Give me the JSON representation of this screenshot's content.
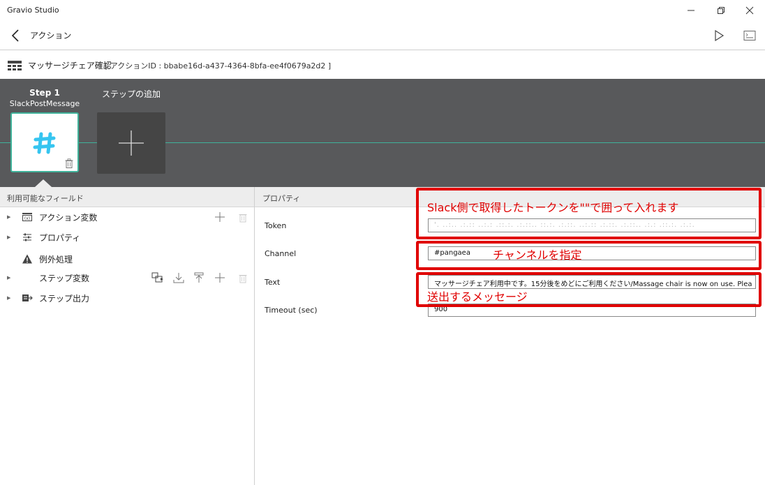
{
  "window": {
    "title": "Gravio Studio"
  },
  "nav": {
    "title": "アクション"
  },
  "action": {
    "name": "マッサージチェア確認",
    "id_text": "[ アクションID : bbabe16d-a437-4364-8bfa-ee4f0679a2d2 ]"
  },
  "steps": {
    "step1": {
      "label": "Step 1",
      "name": "SlackPostMessage",
      "icon": "slack-hash-icon"
    },
    "add_step_label": "ステップの追加"
  },
  "left_panel": {
    "header": "利用可能なフィールド",
    "items": [
      {
        "label": "アクション変数",
        "icon": "variable-icon"
      },
      {
        "label": "プロパティ",
        "icon": "properties-icon"
      },
      {
        "label": "例外処理",
        "icon": "warning-icon"
      },
      {
        "label": "ステップ変数",
        "icon": ""
      },
      {
        "label": "ステップ出力",
        "icon": "output-icon"
      }
    ]
  },
  "right_panel": {
    "header": "プロパティ",
    "properties": [
      {
        "label": "Token",
        "value": "'. ..:.. .:.:: ..:.: .::.:. .:.::.. ::.:. .:.::. ..:.:: .:.::. .:.::.. .:.: .::.:. .:.:."
      },
      {
        "label": "Channel",
        "value": "#pangaea"
      },
      {
        "label": "Text",
        "value": "マッサージチェア利用中です。15分後をめどにご利用ください/Massage chair is now on use. Plea"
      },
      {
        "label": "Timeout (sec)",
        "value": "900"
      }
    ]
  },
  "annotations": {
    "token": "Slack側で取得したトークンを\"\"で囲って入れます",
    "channel": "チャンネルを指定",
    "text": "送出するメッセージ"
  },
  "colors": {
    "accent": "#3fb29a",
    "annotation": "#e00000",
    "step_strip": "#58595b",
    "slack_icon": "#36c5f0"
  }
}
